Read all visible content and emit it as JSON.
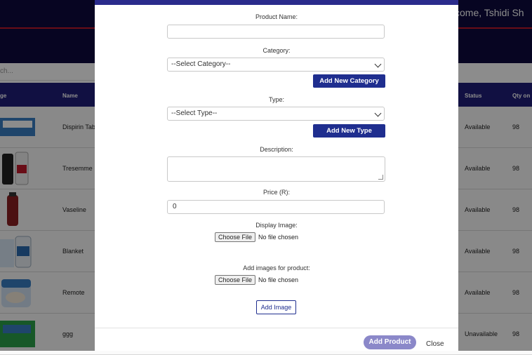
{
  "background": {
    "welcome": "come, Tshidi Sh",
    "search_placeholder": "ch...",
    "table": {
      "columns": [
        "ge",
        "Name",
        "Status",
        "Qty on H"
      ],
      "rows": [
        {
          "name": "Dispirin Tab",
          "status": "Available",
          "qty": "98"
        },
        {
          "name": "Tresemme",
          "status": "Available",
          "qty": "98"
        },
        {
          "name": "Vaseline",
          "status": "Available",
          "qty": "98"
        },
        {
          "name": "Blanket",
          "status": "Available",
          "qty": "98"
        },
        {
          "name": "Remote",
          "status": "Available",
          "qty": "98"
        },
        {
          "name": "ggg",
          "status": "Unavailable",
          "qty": "98"
        }
      ]
    }
  },
  "modal": {
    "product_name_label": "Product Name:",
    "product_name_value": "",
    "category_label": "Category:",
    "category_select": "--Select Category--",
    "add_category_button": "Add New Category",
    "type_label": "Type:",
    "type_select": "--Select Type--",
    "add_type_button": "Add New Type",
    "description_label": "Description:",
    "price_label": "Price (R):",
    "price_value": "0",
    "display_image_label": "Display Image:",
    "choose_file": "Choose File",
    "no_file": "No file chosen",
    "add_images_label": "Add images for product:",
    "add_image_button": "Add Image",
    "add_product_button": "Add Product",
    "close_button": "Close"
  },
  "colors": {
    "header": "#0d0a3e",
    "accent_red": "#c0182a",
    "table_header": "#1f1e78",
    "primary_button": "#1f2e8f",
    "add_product": "#8b88c9"
  }
}
